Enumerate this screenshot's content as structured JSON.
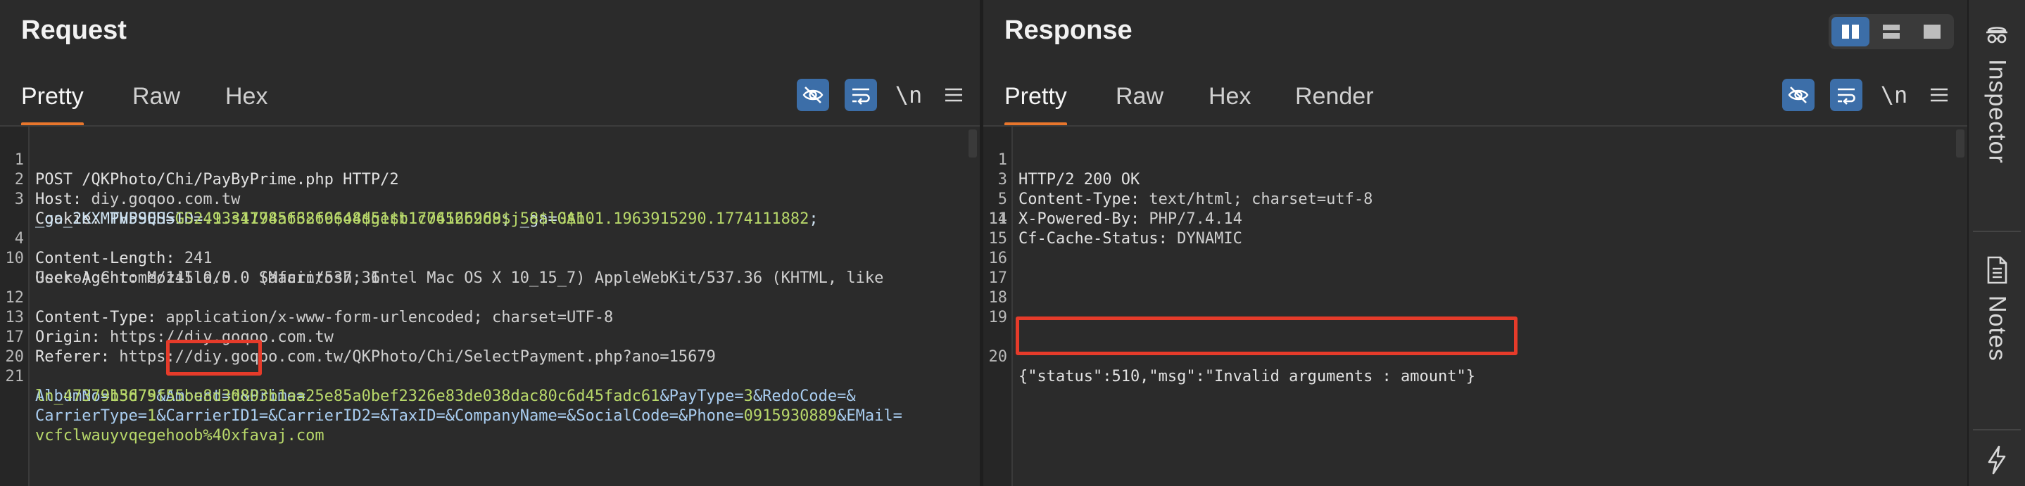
{
  "request": {
    "title": "Request",
    "tabs": [
      "Pretty",
      "Raw",
      "Hex"
    ],
    "active_tab": "Pretty",
    "newline_toggle": "\\n",
    "lines": {
      "l1": {
        "num": "1",
        "text": "POST /QKPhoto/Chi/PayByPrime.php HTTP/2"
      },
      "l2": {
        "num": "2",
        "key": "Host:",
        "val": " diy.goqoo.com.tw"
      },
      "l3": {
        "num": "3",
        "key": "Cookie:",
        "p1k": " PHPSESSID=",
        "p1v": "49334198af38f9648d5ecb1c0612b9d9",
        "p2k": "; _ga=",
        "p2v": "GA1.1.1963915290.1774111882",
        "p2e": ";"
      },
      "l3b": {
        "p3k": "_ga_2KXMTV59QH=",
        "p3v": "GS2.1.s1774566266$o4$g1$t1774566268$j58$l0$h0"
      },
      "l4": {
        "num": "4",
        "key": "Content-Length:",
        "val": " 241"
      },
      "l10": {
        "num": "10",
        "key": "User-Agent:",
        "val": " Mozilla/5.0 (Macintosh; Intel Mac OS X 10_15_7) AppleWebKit/537.36 (KHTML, like"
      },
      "l10b": {
        "val": "Gecko) Chrome/145.0.0.0 Safari/537.36"
      },
      "l12": {
        "num": "12",
        "key": "Content-Type:",
        "val": " application/x-www-form-urlencoded; charset=UTF-8"
      },
      "l13": {
        "num": "13",
        "key": "Origin:",
        "val": " https://diy.goqoo.com.tw"
      },
      "l17": {
        "num": "17",
        "key": "Referer:",
        "val": " https://diy.goqoo.com.tw/QKPhoto/Chi/SelectPayment.php?ano=15679"
      },
      "l20": {
        "num": "20"
      },
      "l21": {
        "num": "21",
        "k1": "AlbumNo=",
        "v1": "15679",
        "k2": "&Amount=",
        "v2": "0",
        "k3": "&Prime=",
        "v3": ""
      },
      "l21b": {
        "v3": "ln_47379b3d75f55be8d3d803b1aa25e85a0bef2326e83de038dac80c6d45fadc61",
        "k4": "&PayType=",
        "v4": "3",
        "k5": "&RedoCode=&"
      },
      "l21c": {
        "k6": "CarrierType=",
        "v6": "1",
        "k7": "&CarrierID1=&CarrierID2=&TaxID=&CompanyName=&SocialCode=&Phone=",
        "v7": "0915930889",
        "k8": "&EMail="
      },
      "l21d": {
        "v8": "vcfclwauyvqegehoob%40xfavaj.com"
      }
    }
  },
  "response": {
    "title": "Response",
    "tabs": [
      "Pretty",
      "Raw",
      "Hex",
      "Render"
    ],
    "active_tab": "Pretty",
    "newline_toggle": "\\n",
    "lines": {
      "l1": {
        "num": "1",
        "text": "HTTP/2 200 OK"
      },
      "l3": {
        "num": "3",
        "key": "Content-Type:",
        "val": " text/html; charset=utf-8"
      },
      "l5": {
        "num": "5",
        "key": "X-Powered-By:",
        "val": " PHP/7.4.14"
      },
      "l11": {
        "num": "11",
        "key": "Cf-Cache-Status:",
        "val": " DYNAMIC"
      },
      "l14": {
        "num": "14"
      },
      "l15": {
        "num": "15"
      },
      "l16": {
        "num": "16"
      },
      "l17": {
        "num": "17"
      },
      "l18": {
        "num": "18"
      },
      "l19": {
        "num": "19"
      },
      "l20": {
        "num": "20",
        "text": "{\"status\":510,\"msg\":\"Invalid arguments : amount\"}"
      }
    }
  },
  "side_rail": {
    "inspector_label": "Inspector",
    "notes_label": "Notes"
  },
  "colors": {
    "accent_tab": "#e8762c",
    "toggle_blue": "#3c6ea8",
    "highlight_red": "#e63b2a"
  },
  "icons": [
    "hide-icon",
    "wrap-icon",
    "menu-icon",
    "layout-split-icon",
    "layout-stack-icon",
    "layout-single-icon",
    "inspector-icon",
    "notes-icon",
    "bolt-icon"
  ]
}
